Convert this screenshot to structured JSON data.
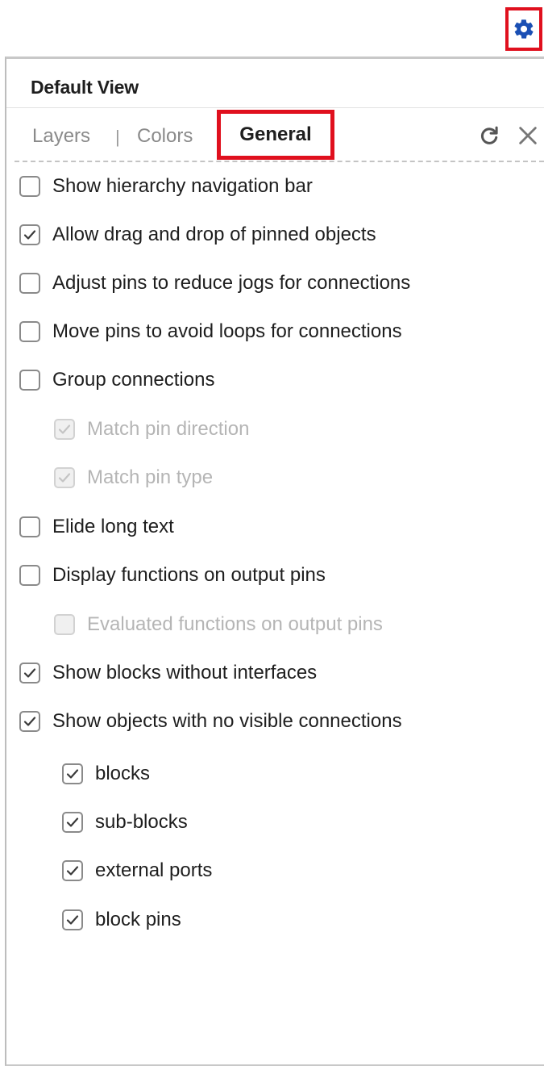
{
  "toolbar": {
    "settings_icon": "gear-icon",
    "accent_color": "#1a4fb4",
    "highlight_color": "#e0101e"
  },
  "panel": {
    "title": "Default View",
    "tabs": [
      {
        "label": "Layers",
        "active": false
      },
      {
        "label": "Colors",
        "active": false
      },
      {
        "label": "General",
        "active": true
      }
    ],
    "tab_separator": "|",
    "actions": {
      "refresh_icon": "refresh-icon",
      "close_icon": "close-icon"
    }
  },
  "options": [
    {
      "label": "Show hierarchy navigation bar",
      "checked": false,
      "enabled": true,
      "level": 0
    },
    {
      "label": "Allow drag and drop of pinned objects",
      "checked": true,
      "enabled": true,
      "level": 0
    },
    {
      "label": "Adjust pins to reduce jogs for connections",
      "checked": false,
      "enabled": true,
      "level": 0
    },
    {
      "label": "Move pins to avoid loops for connections",
      "checked": false,
      "enabled": true,
      "level": 0
    },
    {
      "label": "Group connections",
      "checked": false,
      "enabled": true,
      "level": 0
    },
    {
      "label": "Match pin direction",
      "checked": true,
      "enabled": false,
      "level": 1
    },
    {
      "label": "Match pin type",
      "checked": true,
      "enabled": false,
      "level": 1
    },
    {
      "label": "Elide long text",
      "checked": false,
      "enabled": true,
      "level": 0
    },
    {
      "label": "Display functions on output pins",
      "checked": false,
      "enabled": true,
      "level": 0
    },
    {
      "label": "Evaluated functions on output pins",
      "checked": false,
      "enabled": false,
      "level": 1
    },
    {
      "label": "Show blocks without interfaces",
      "checked": true,
      "enabled": true,
      "level": 0
    },
    {
      "label": "Show objects with no visible connections",
      "checked": true,
      "enabled": true,
      "level": 0
    },
    {
      "label": "blocks",
      "checked": true,
      "enabled": true,
      "level": 2
    },
    {
      "label": "sub-blocks",
      "checked": true,
      "enabled": true,
      "level": 2
    },
    {
      "label": "external ports",
      "checked": true,
      "enabled": true,
      "level": 2
    },
    {
      "label": "block pins",
      "checked": true,
      "enabled": true,
      "level": 2
    }
  ]
}
